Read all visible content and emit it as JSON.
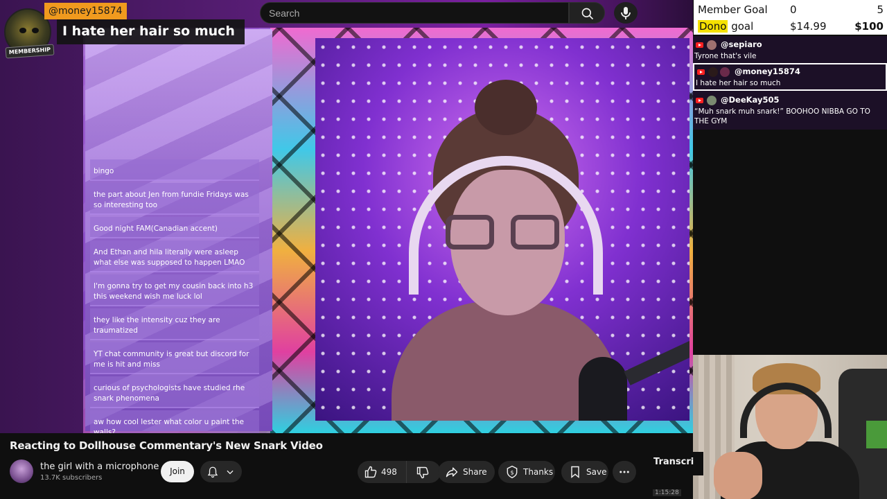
{
  "search": {
    "placeholder": "Search"
  },
  "overlay_membership": {
    "username": "@money15874",
    "message": "I hate her hair so much",
    "badge_label": "MEMBERSHIP"
  },
  "goals": {
    "member_goal": {
      "label": "Member Goal",
      "current": "0",
      "target": "5"
    },
    "dono_goal": {
      "label_highlight": "Dono",
      "label_rest": " goal",
      "current": "$14.99",
      "target": "$100"
    }
  },
  "stream_chat": [
    {
      "user": "@sepiaro",
      "text": "Tyrone that's vile",
      "highlighted": false
    },
    {
      "user": "@money15874",
      "text": "I hate her hair so much",
      "highlighted": true
    },
    {
      "user": "@DeeKay505",
      "text": "“Muh snark muh snark!” BOOHOO NIBBA GO TO THE GYM",
      "highlighted": false
    }
  ],
  "embedded_chat": [
    {
      "text": "bingo"
    },
    {
      "text": "the part about Jen from fundie Fridays was so interesting too"
    },
    {
      "text": "Good night FAM(Canadian accent)"
    },
    {
      "text": "And Ethan and hila literally were asleep what else was supposed to happen LMAO"
    },
    {
      "text": "I'm gonna try to get my cousin back into h3 this weekend wish me luck lol"
    },
    {
      "text": "they like the intensity cuz they are traumatized"
    },
    {
      "text": "YT chat community is great but discord for me is hit and miss"
    },
    {
      "text": "curious of psychologists have studied rhe snark phenomena"
    },
    {
      "text": "aw how cool lester what color u paint the walls?"
    }
  ],
  "video": {
    "title": "Reacting to Dollhouse Commentary's New Snark Video"
  },
  "channel": {
    "name": "the girl with a microphone",
    "subscribers": "13.7K subscribers",
    "join_label": "Join"
  },
  "actions": {
    "likes": "498",
    "share_label": "Share",
    "thanks_label": "Thanks",
    "save_label": "Save"
  },
  "side_panel": {
    "transcript_label": "Transcri",
    "timestamp": "1:15:28"
  },
  "colors": {
    "background": "#0f0f0f",
    "pill": "#272727",
    "membership_name_bg": "#f09a1e",
    "dono_highlight": "#f5e100",
    "youtube_red": "#ff2020"
  }
}
